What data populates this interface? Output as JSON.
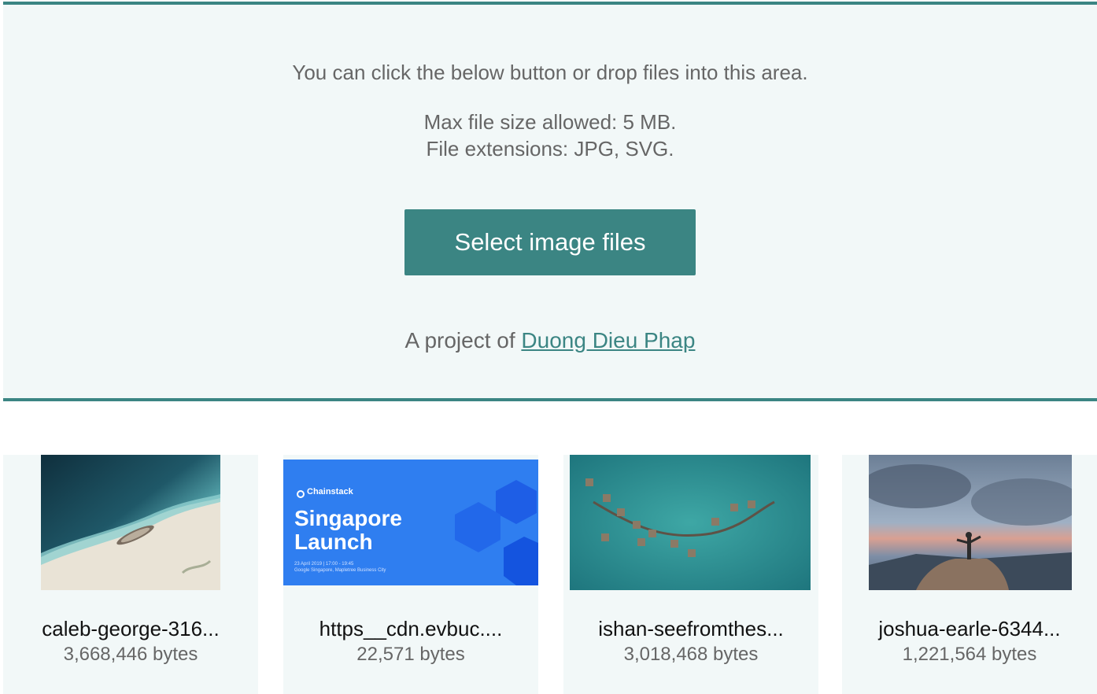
{
  "dropzone": {
    "instruction": "You can click the below button or drop files into this area.",
    "max_size": "Max file size allowed: 5 MB.",
    "extensions": "File extensions: JPG, SVG.",
    "select_button": "Select image files",
    "credit_prefix": "A project of ",
    "credit_link": "Duong Dieu Phap"
  },
  "files": [
    {
      "name": "caleb-george-316...",
      "size": "3,668,446 bytes"
    },
    {
      "name": "https__cdn.evbuc....",
      "size": "22,571 bytes",
      "thumb_text": {
        "brand": "Chainstack",
        "title_line1": "Singapore",
        "title_line2": "Launch",
        "date": "23 April 2019 | 17:00 - 19:45",
        "venue": "Google Singapore, Mapletree Business City"
      }
    },
    {
      "name": "ishan-seefromthes...",
      "size": "3,018,468 bytes"
    },
    {
      "name": "joshua-earle-6344...",
      "size": "1,221,564 bytes"
    }
  ],
  "colors": {
    "accent": "#3b8583",
    "dropzone_bg": "#f2f8f8",
    "muted_text": "#666666"
  }
}
